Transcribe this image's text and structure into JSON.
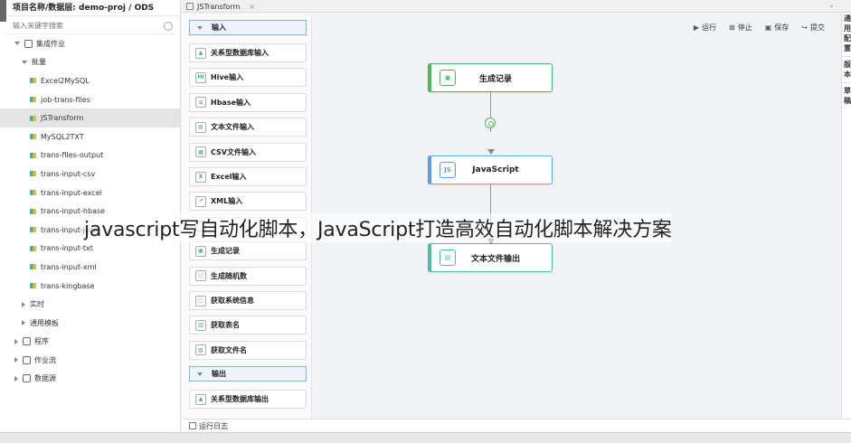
{
  "sidebar": {
    "header": "项目名称/数据层:   demo-proj / ODS",
    "search_placeholder": "输入关键字搜索",
    "tree": [
      {
        "label": "集成作业",
        "kind": "folder-open",
        "level": 0
      },
      {
        "label": "批量",
        "kind": "folder-open",
        "level": 1
      },
      {
        "label": "Excel2MySQL",
        "kind": "leaf",
        "level": 2
      },
      {
        "label": "job-trans-files",
        "kind": "leaf",
        "level": 2
      },
      {
        "label": "JSTransform",
        "kind": "leaf",
        "level": 2,
        "selected": true
      },
      {
        "label": "MySQL2TXT",
        "kind": "leaf",
        "level": 2
      },
      {
        "label": "trans-files-output",
        "kind": "leaf",
        "level": 2
      },
      {
        "label": "trans-input-csv",
        "kind": "leaf",
        "level": 2
      },
      {
        "label": "trans-input-excel",
        "kind": "leaf",
        "level": 2
      },
      {
        "label": "trans-input-hbase",
        "kind": "leaf",
        "level": 2
      },
      {
        "label": "trans-input-json",
        "kind": "leaf",
        "level": 2
      },
      {
        "label": "trans-input-txt",
        "kind": "leaf",
        "level": 2
      },
      {
        "label": "trans-input-xml",
        "kind": "leaf",
        "level": 2
      },
      {
        "label": "trans-kingbase",
        "kind": "leaf",
        "level": 2
      },
      {
        "label": "实时",
        "kind": "folder-closed",
        "level": 1
      },
      {
        "label": "通用模板",
        "kind": "folder-closed",
        "level": 1
      },
      {
        "label": "程序",
        "kind": "root-closed",
        "level": 0
      },
      {
        "label": "作业流",
        "kind": "root-closed",
        "level": 0
      },
      {
        "label": "数据源",
        "kind": "root-closed",
        "level": 0
      }
    ]
  },
  "tab": {
    "label": "JSTransform",
    "close": "×"
  },
  "palette": {
    "input_section": "输入",
    "input_items": [
      {
        "label": "关系型数据库输入",
        "icon": "database-icon",
        "glyph": "▲"
      },
      {
        "label": "Hive输入",
        "icon": "hive-icon",
        "glyph": "HI"
      },
      {
        "label": "Hbase输入",
        "icon": "hbase-icon",
        "glyph": "≡"
      },
      {
        "label": "文本文件输入",
        "icon": "text-file-icon",
        "glyph": "▤"
      },
      {
        "label": "CSV文件输入",
        "icon": "csv-icon",
        "glyph": "▦"
      },
      {
        "label": "Excel输入",
        "icon": "excel-icon",
        "glyph": "X"
      },
      {
        "label": "XML输入",
        "icon": "xml-icon",
        "glyph": "↗"
      },
      {
        "label": "",
        "icon": "hidden-item-icon",
        "glyph": ""
      },
      {
        "label": "生成记录",
        "icon": "record-icon",
        "glyph": "▣"
      },
      {
        "label": "生成随机数",
        "icon": "random-icon",
        "glyph": "⬡"
      },
      {
        "label": "获取系统信息",
        "icon": "system-info-icon",
        "glyph": "▢"
      },
      {
        "label": "获取表名",
        "icon": "table-name-icon",
        "glyph": "▥"
      },
      {
        "label": "获取文件名",
        "icon": "file-name-icon",
        "glyph": "▧"
      }
    ],
    "output_section": "输出",
    "output_items": [
      {
        "label": "关系型数据库输出",
        "icon": "database-output-icon",
        "glyph": "▲"
      }
    ]
  },
  "toolbar": {
    "run": "运行",
    "stop": "停止",
    "save": "保存",
    "submit": "提交"
  },
  "flow": {
    "nodes": [
      {
        "label": "生成记录",
        "icon_glyph": "▣",
        "color": "#4db85c"
      },
      {
        "label": "JavaScript",
        "icon_glyph": "JS",
        "color": "#5a9ee6"
      },
      {
        "label": "文本文件输出",
        "icon_glyph": "▤",
        "color": "#4ac0a8"
      }
    ]
  },
  "right_panel": {
    "group1": [
      "通",
      "用",
      "配",
      "置"
    ],
    "group2": [
      "版",
      "本"
    ],
    "group3": [
      "草",
      "稿"
    ]
  },
  "bottom": {
    "log_label": "运行日志"
  },
  "overlay_caption": "javascript写自动化脚本，JavaScript打造高效自动化脚本解决方案"
}
